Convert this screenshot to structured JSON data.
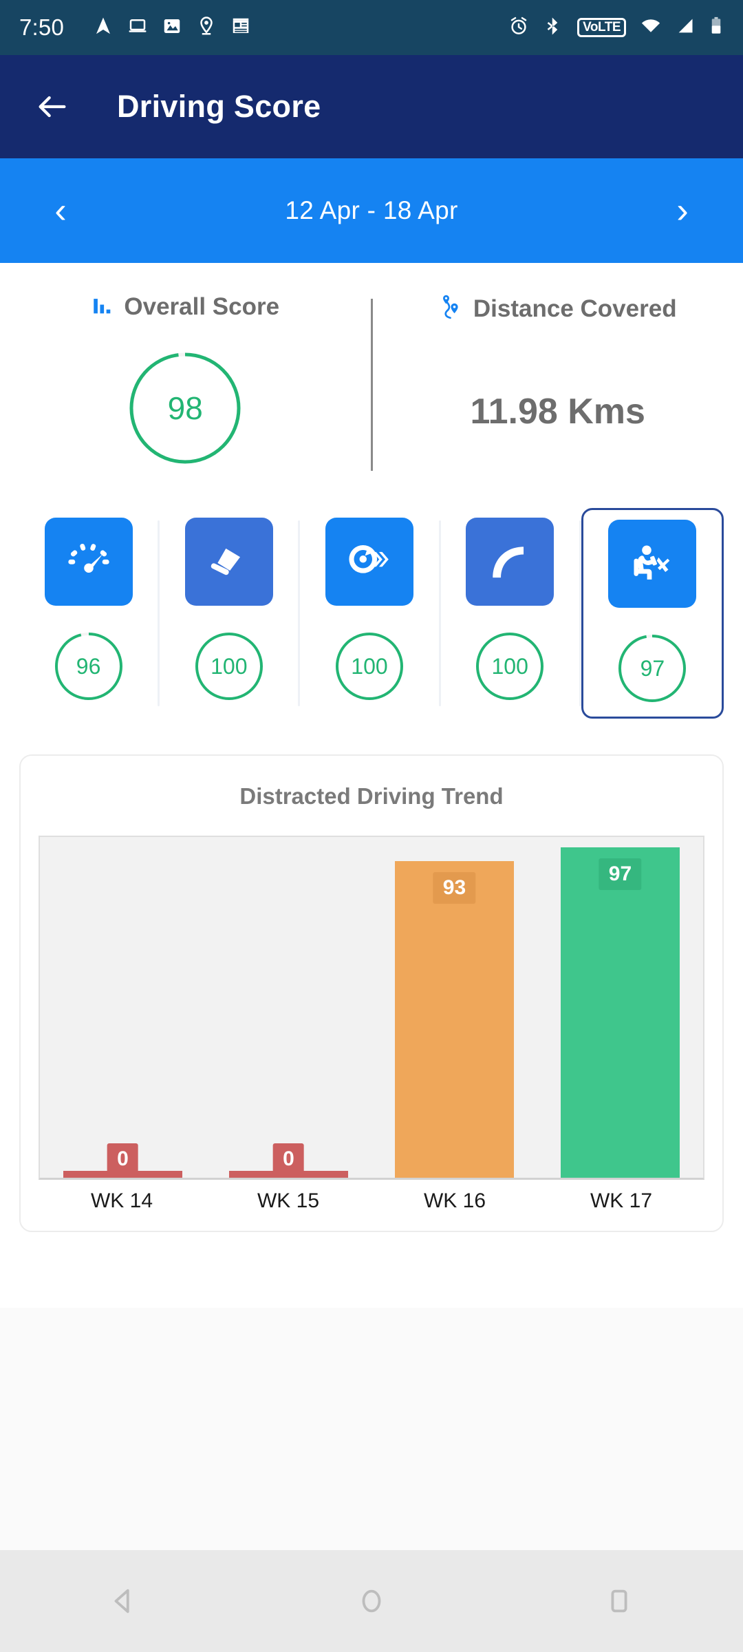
{
  "status_bar": {
    "time": "7:50",
    "left_icons": [
      "navigation-icon",
      "laptop-icon",
      "image-icon",
      "location-pin-icon",
      "news-icon"
    ],
    "right_icons": [
      "alarm-icon",
      "bluetooth-icon",
      "volte-icon",
      "wifi-icon",
      "cellular-signal-icon",
      "battery-icon"
    ],
    "volte_label": "VoLTE"
  },
  "app_bar": {
    "back_label": "Back",
    "title": "Driving Score"
  },
  "week_selector": {
    "prev_label": "‹",
    "next_label": "›",
    "range": "12 Apr - 18 Apr"
  },
  "summary": {
    "overall": {
      "title": "Overall Score",
      "icon": "bar-chart-icon",
      "value": "98",
      "percent": 98
    },
    "distance": {
      "title": "Distance Covered",
      "icon": "route-pin-icon",
      "value": "11.98 Kms"
    }
  },
  "metrics": [
    {
      "icon": "speedometer-icon",
      "name": "overspeeding",
      "score": "96",
      "percent": 96,
      "selected": false,
      "icon_style": "primary"
    },
    {
      "icon": "brake-pedal-icon",
      "name": "harsh-braking",
      "score": "100",
      "percent": 100,
      "selected": false,
      "icon_style": "alt"
    },
    {
      "icon": "acceleration-icon",
      "name": "harsh-acceleration",
      "score": "100",
      "percent": 100,
      "selected": false,
      "icon_style": "primary"
    },
    {
      "icon": "curved-road-icon",
      "name": "cornering",
      "score": "100",
      "percent": 100,
      "selected": false,
      "icon_style": "alt"
    },
    {
      "icon": "distracted-driver-icon",
      "name": "distracted-driving",
      "score": "97",
      "percent": 97,
      "selected": true,
      "icon_style": "primary"
    }
  ],
  "chart_data": {
    "type": "bar",
    "title": "Distracted Driving Trend",
    "categories": [
      "WK 14",
      "WK 15",
      "WK 16",
      "WK 17"
    ],
    "values": [
      0,
      0,
      93,
      97
    ],
    "labels": [
      "0",
      "0",
      "93",
      "97"
    ],
    "bar_colors": [
      "#cc5f5f",
      "#cc5f5f",
      "#efa75a",
      "#3fc68c"
    ],
    "label_bg": [
      "#cc5f5f",
      "#cc5f5f",
      "#e39a4e",
      "#35b77f"
    ],
    "xlabel": "",
    "ylabel": "",
    "ylim": [
      0,
      100
    ],
    "grid": false,
    "legend": "none",
    "plot_background": "#f2f2f2"
  },
  "nav_bar": {
    "items": [
      "back-triangle-icon",
      "home-circle-icon",
      "recents-square-icon"
    ]
  },
  "colors": {
    "status_bar": "#174562",
    "app_bar": "#152a6e",
    "week_bar": "#1583f2",
    "accent_blue": "#1583f2",
    "accent_blue_alt": "#3a72d8",
    "green": "#22b573",
    "orange": "#efa75a",
    "red": "#cc5f5f",
    "selected_border": "#2a4b9b",
    "text_gray": "#6d6d6d"
  }
}
